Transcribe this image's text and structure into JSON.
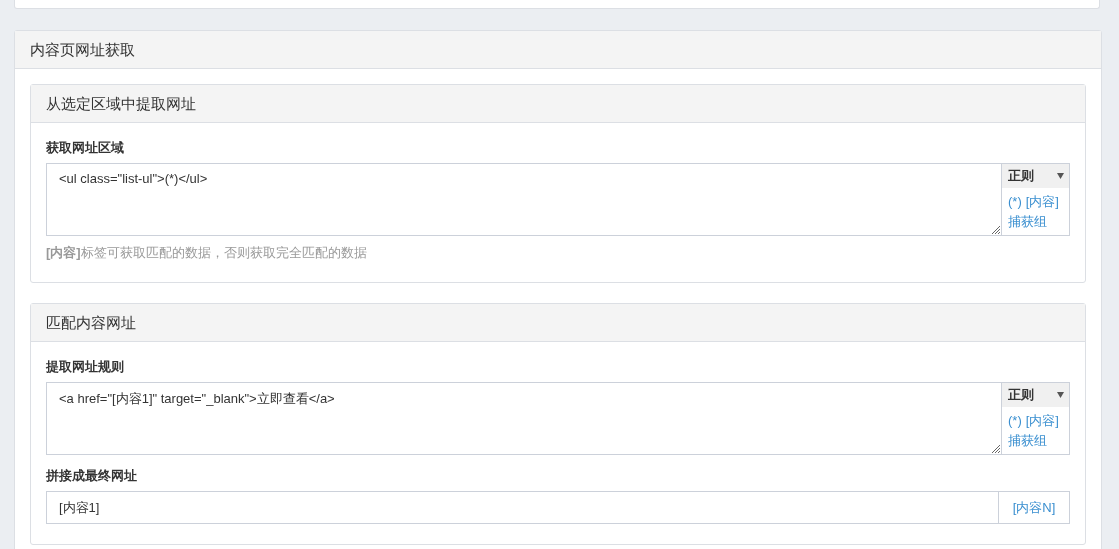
{
  "panel": {
    "title": "内容页网址获取",
    "sections": [
      {
        "title": "从选定区域中提取网址",
        "fields": [
          {
            "kind": "textarea",
            "label": "获取网址区域",
            "value": "<ul class=\"list-ul\">(*)</ul>",
            "addon": {
              "title": "正则",
              "links": [
                "(*)",
                "[内容]",
                "捕获组"
              ]
            },
            "help": "**[内容]**标签可获取匹配的数据，否则获取完全匹配的数据"
          }
        ]
      },
      {
        "title": "匹配内容网址",
        "fields": [
          {
            "kind": "textarea",
            "label": "提取网址规则",
            "value": "<a href=\"[内容1]\" target=\"_blank\">立即查看</a>",
            "addon": {
              "title": "正则",
              "links": [
                "(*)",
                "[内容]",
                "捕获组"
              ]
            }
          },
          {
            "kind": "input",
            "label": "拼接成最终网址",
            "value": "[内容1]",
            "addon": {
              "links": [
                "[内容N]"
              ]
            }
          }
        ]
      }
    ]
  }
}
